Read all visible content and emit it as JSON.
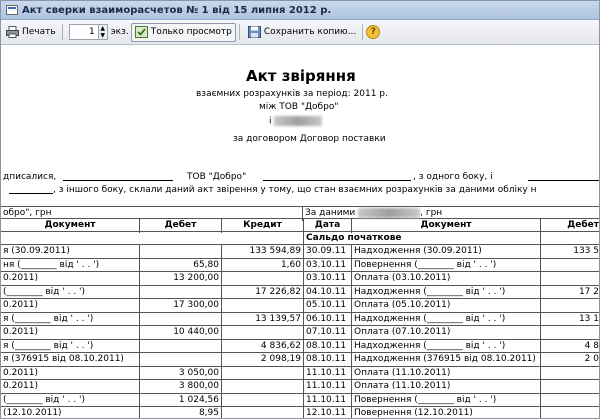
{
  "window": {
    "title": "Акт сверки взаиморасчетов № 1 від 15 липня 2012 р."
  },
  "toolbar": {
    "print": "Печать",
    "copies_value": "1",
    "copies_unit": "экз.",
    "view_only": "Только просмотр",
    "save_copy": "Сохранить копию..."
  },
  "doc": {
    "title": "Акт звіряння",
    "subtitle": "взаємних розрахунків за період: 2011 р.",
    "between": "між ТОВ \"Добро\"",
    "and": "і",
    "contract": "за договором Договор поставки",
    "para1_a": "дписалися,",
    "para1_b": "ТОВ  \"Добро\"",
    "para1_c": ", з одного боку, і",
    "para2": ", з іншого боку, склали даний акт звірення у тому, що стан взаємних розрахунків за даними обліку н",
    "left_header": "обро\", грн",
    "right_header_prefix": "За даними",
    "right_header_suffix": ", грн"
  },
  "table": {
    "columns": [
      "Документ",
      "Дебет",
      "Кредит",
      "Дата",
      "Документ",
      "Дебет"
    ],
    "opening_balance": "Сальдо початкове",
    "rows": [
      {
        "ldoc": "я (30.09.2011)",
        "ldeb": "",
        "lcred": "133 594,89",
        "date": "30.09.11",
        "rdoc": "Надходження (30.09.2011)",
        "rdeb": "133 5"
      },
      {
        "ldoc": "ня (________ від ' .  .  ')",
        "ldeb": "65,80",
        "lcred": "1,60",
        "date": "03.10.11",
        "rdoc": "Повернення (________ від ' .  .  ')",
        "rdeb": ""
      },
      {
        "ldoc": "0.2011)",
        "ldeb": "13 200,00",
        "lcred": "",
        "date": "03.10.11",
        "rdoc": "Оплата (03.10.2011)",
        "rdeb": ""
      },
      {
        "ldoc": "(________ від ' .  .  ')",
        "ldeb": "",
        "lcred": "17 226,82",
        "date": "04.10.11",
        "rdoc": "Надходження (________ від ' .  .  ')",
        "rdeb": "17 2"
      },
      {
        "ldoc": "0.2011)",
        "ldeb": "17 300,00",
        "lcred": "",
        "date": "05.10.11",
        "rdoc": "Оплата (05.10.2011)",
        "rdeb": ""
      },
      {
        "ldoc": "я (________ від ' .  .  ')",
        "ldeb": "",
        "lcred": "13 139,57",
        "date": "06.10.11",
        "rdoc": "Надходження (________ від ' .  .  ')",
        "rdeb": "13 1"
      },
      {
        "ldoc": "0.2011)",
        "ldeb": "10 440,00",
        "lcred": "",
        "date": "07.10.11",
        "rdoc": "Оплата (07.10.2011)",
        "rdeb": ""
      },
      {
        "ldoc": "я (________ від ' .  .  ')",
        "ldeb": "",
        "lcred": "4 836,62",
        "date": "08.10.11",
        "rdoc": "Надходження (________ від ' .  .  ')",
        "rdeb": "4 8"
      },
      {
        "ldoc": "я (376915 від 08.10.2011)",
        "ldeb": "",
        "lcred": "2 098,19",
        "date": "08.10.11",
        "rdoc": "Надходження (376915 від 08.10.2011)",
        "rdeb": "2 0"
      },
      {
        "ldoc": "0.2011)",
        "ldeb": "3 050,00",
        "lcred": "",
        "date": "11.10.11",
        "rdoc": "Оплата (11.10.2011)",
        "rdeb": ""
      },
      {
        "ldoc": "0.2011)",
        "ldeb": "3 800,00",
        "lcred": "",
        "date": "11.10.11",
        "rdoc": "Оплата (11.10.2011)",
        "rdeb": ""
      },
      {
        "ldoc": "(________ від ' .  .  ')",
        "ldeb": "1 024,56",
        "lcred": "",
        "date": "11.10.11",
        "rdoc": "Повернення (________ від ' .  .  ')",
        "rdeb": ""
      },
      {
        "ldoc": "(12.10.2011)",
        "ldeb": "8,95",
        "lcred": "",
        "date": "12.10.11",
        "rdoc": "Повернення (12.10.2011)",
        "rdeb": ""
      }
    ]
  }
}
